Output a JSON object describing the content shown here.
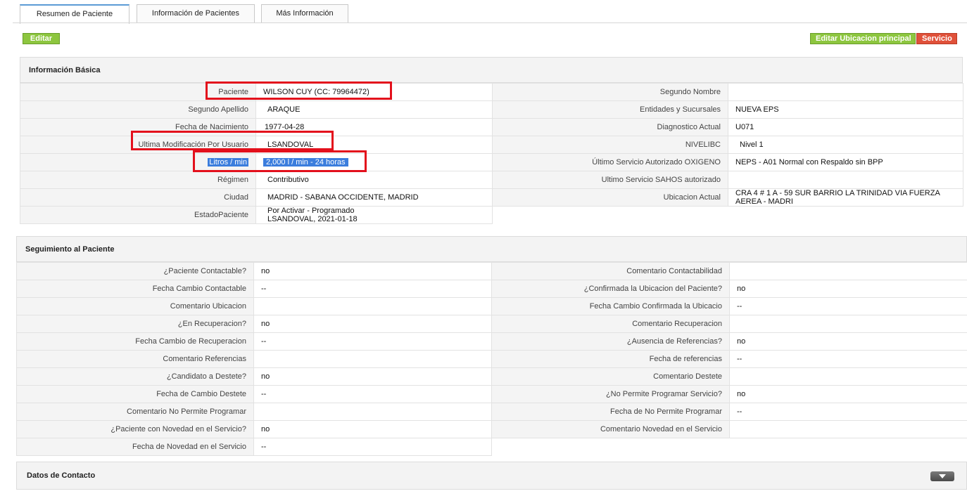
{
  "tabs": [
    {
      "label": "Resumen de Paciente",
      "active": true
    },
    {
      "label": "Información de Pacientes",
      "active": false
    },
    {
      "label": "Más Información",
      "active": false
    }
  ],
  "toolbar": {
    "edit_label": "Editar",
    "edit_location_label": "Editar Ubicacion principal",
    "service_label": "Servicio"
  },
  "basic_info": {
    "title": "Información Básica",
    "left": [
      {
        "label": "Paciente",
        "value": "WILSON CUY (CC: 79964472)"
      },
      {
        "label": "Segundo Apellido",
        "value": "ARAQUE"
      },
      {
        "label": "Fecha de Nacimiento",
        "value": "1977-04-28"
      },
      {
        "label": "Ultima Modificación Por Usuario",
        "value": "LSANDOVAL"
      },
      {
        "label": "Litros / min",
        "value": "2,000 l / min - 24 horas"
      },
      {
        "label": "Régimen",
        "value": "Contributivo"
      },
      {
        "label": "Ciudad",
        "value": "MADRID - SABANA OCCIDENTE, MADRID"
      },
      {
        "label": "EstadoPaciente",
        "value": "Por Activar - Programado",
        "value2": "LSANDOVAL, 2021-01-18"
      }
    ],
    "right": [
      {
        "label": "Segundo Nombre",
        "value": ""
      },
      {
        "label": "Entidades y Sucursales",
        "value": "NUEVA EPS"
      },
      {
        "label": "Diagnostico Actual",
        "value": "U071"
      },
      {
        "label": "NIVELIBC",
        "value": "Nivel 1"
      },
      {
        "label": "Último Servicio Autorizado OXIGENO",
        "value": "NEPS - A01 Normal con Respaldo sin BPP"
      },
      {
        "label": "Ultimo Servicio SAHOS autorizado",
        "value": ""
      },
      {
        "label": "Ubicacion Actual",
        "value": "CRA 4 # 1 A - 59 SUR BARRIO LA TRINIDAD VIA FUERZA AEREA - MADRI"
      }
    ]
  },
  "followup": {
    "title": "Seguimiento al Paciente",
    "left": [
      {
        "label": "¿Paciente Contactable?",
        "value": "no"
      },
      {
        "label": "Fecha Cambio Contactable",
        "value": "--"
      },
      {
        "label": "Comentario Ubicacion",
        "value": ""
      },
      {
        "label": "¿En Recuperacion?",
        "value": "no"
      },
      {
        "label": "Fecha Cambio de Recuperacion",
        "value": "--"
      },
      {
        "label": "Comentario Referencias",
        "value": ""
      },
      {
        "label": "¿Candidato a Destete?",
        "value": "no"
      },
      {
        "label": "Fecha de Cambio Destete",
        "value": "--"
      },
      {
        "label": "Comentario No Permite Programar",
        "value": ""
      },
      {
        "label": "¿Paciente con Novedad en el Servicio?",
        "value": "no"
      },
      {
        "label": "Fecha de Novedad en el Servicio",
        "value": "--"
      }
    ],
    "right": [
      {
        "label": "Comentario Contactabilidad",
        "value": ""
      },
      {
        "label": "¿Confirmada la Ubicacion del Paciente?",
        "value": "no"
      },
      {
        "label": "Fecha Cambio Confirmada la Ubicacio",
        "value": "--"
      },
      {
        "label": "Comentario Recuperacion",
        "value": ""
      },
      {
        "label": "¿Ausencia de Referencias?",
        "value": "no"
      },
      {
        "label": "Fecha de referencias",
        "value": "--"
      },
      {
        "label": "Comentario Destete",
        "value": ""
      },
      {
        "label": "¿No Permite Programar Servicio?",
        "value": "no"
      },
      {
        "label": "Fecha de No Permite Programar",
        "value": "--"
      },
      {
        "label": "Comentario Novedad en el Servicio",
        "value": ""
      }
    ]
  },
  "contact": {
    "title": "Datos de Contacto"
  },
  "colors": {
    "button_green": "#8dc63f",
    "button_red": "#e0513a",
    "highlight_box": "#e3101c",
    "selection_blue": "#3b7ddd"
  }
}
